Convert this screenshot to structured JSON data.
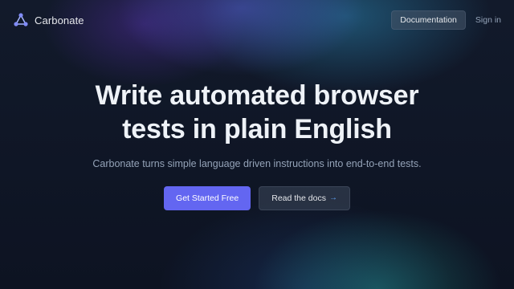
{
  "nav": {
    "brand_name": "Carbonate",
    "brand_icon": "carbonate-molecule-icon",
    "documentation_label": "Documentation",
    "signin_label": "Sign in"
  },
  "hero": {
    "title_line1": "Write automated browser",
    "title_line2": "tests in plain English",
    "subtitle": "Carbonate turns simple language driven instructions into end-to-end tests.",
    "primary_cta": "Get Started Free",
    "secondary_cta": "Read the docs",
    "secondary_cta_icon": "arrow-right-icon"
  },
  "colors": {
    "background": "#0f1524",
    "accent": "#6366f1",
    "link_arrow": "#60a5fa"
  }
}
